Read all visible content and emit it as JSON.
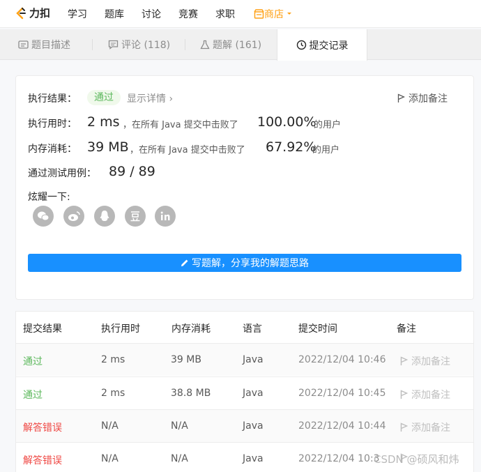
{
  "nav": {
    "logo": "力扣",
    "items": [
      "学习",
      "题库",
      "讨论",
      "竞赛",
      "求职"
    ],
    "shop": "商店"
  },
  "tabs": [
    "题目描述",
    "评论 (118)",
    "题解 (161)",
    "提交记录"
  ],
  "result": {
    "label": "执行结果：",
    "status": "通过",
    "detail": "显示详情 ›",
    "add_note": "添加备注",
    "time_label": "执行用时：",
    "time_value": "2 ms",
    "time_text": "，在所有 Java 提交中击败了",
    "time_pct": "100.00%",
    "users": "的用户",
    "mem_label": "内存消耗：",
    "mem_value": "39 MB",
    "mem_text": "，在所有 Java 提交中击败了",
    "mem_pct": "67.92%",
    "cases_label": "通过测试用例：",
    "cases_value": "89 / 89",
    "share_label": "炫耀一下:",
    "share_icons": [
      "wechat-icon",
      "weibo-icon",
      "qq-icon",
      "douban-icon",
      "linkedin-icon"
    ],
    "write_button": "写题解，分享我的解题思路"
  },
  "table": {
    "headers": [
      "提交结果",
      "执行用时",
      "内存消耗",
      "语言",
      "提交时间",
      "备注"
    ],
    "rows": [
      {
        "status": "通过",
        "time": "2 ms",
        "memory": "39 MB",
        "lang": "Java",
        "date": "2022/12/04 10:46",
        "note": "添加备注"
      },
      {
        "status": "通过",
        "time": "2 ms",
        "memory": "38.8 MB",
        "lang": "Java",
        "date": "2022/12/04 10:45",
        "note": "添加备注"
      },
      {
        "status": "解答错误",
        "time": "N/A",
        "memory": "N/A",
        "lang": "Java",
        "date": "2022/12/04 10:44",
        "note": "添加备注"
      },
      {
        "status": "解答错误",
        "time": "N/A",
        "memory": "N/A",
        "lang": "Java",
        "date": "2022/12/04 10:3",
        "note": ""
      }
    ]
  },
  "watermark": "CSDN @硕风和炜",
  "colors": {
    "accent": "#1890ff",
    "pass": "#5cb85c",
    "fail": "#ef4743",
    "shop": "#ffa116"
  }
}
